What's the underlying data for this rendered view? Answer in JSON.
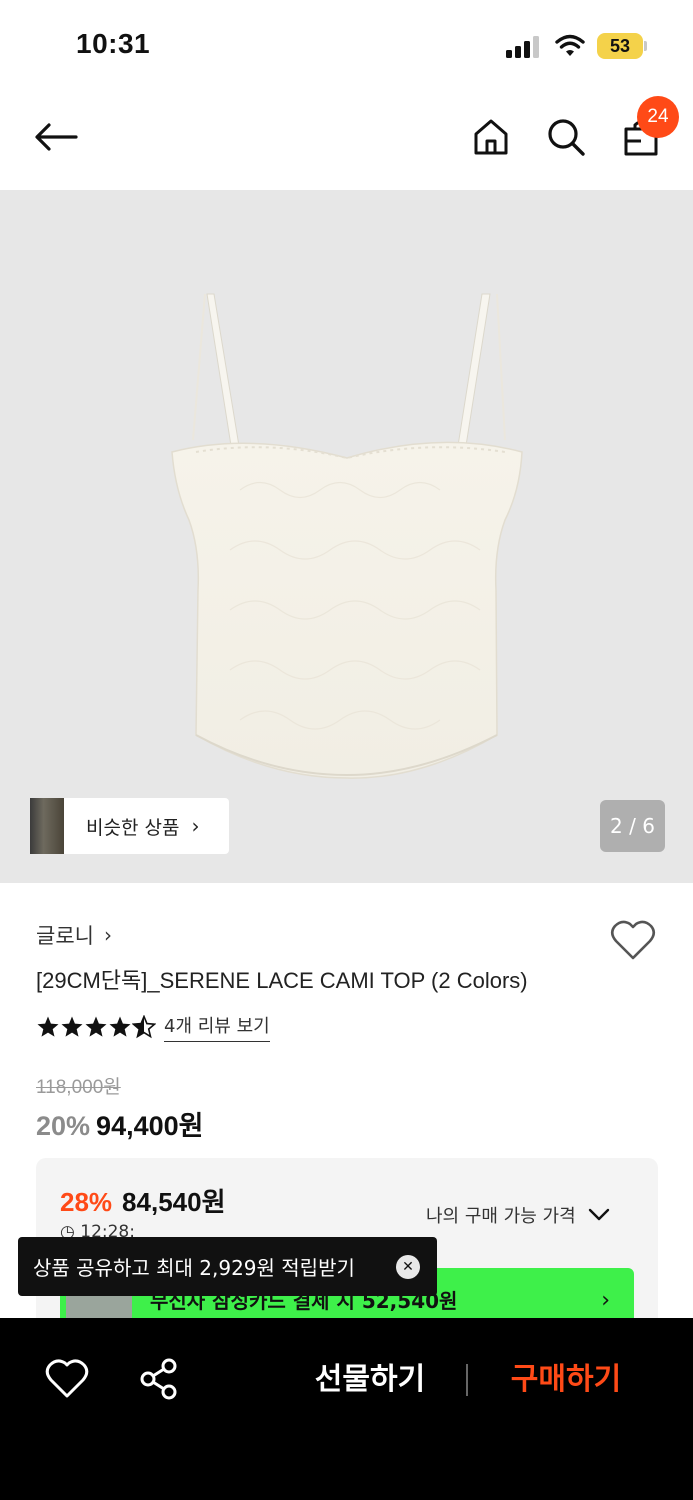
{
  "status_bar": {
    "time": "10:31",
    "battery": "53"
  },
  "nav": {
    "cart_count": "24"
  },
  "gallery": {
    "similar_label": "비슷한 상품",
    "pager": "2 / 6"
  },
  "product": {
    "brand": "글로니",
    "title": "[29CM단독]_SERENE LACE CAMI TOP (2 Colors)",
    "rating": 4.5,
    "review_link": "4개 리뷰 보기",
    "original_price": "118,000원",
    "discount": "20%",
    "sale_price": "94,400원"
  },
  "best_price": {
    "discount": "28%",
    "price": "84,540원",
    "timer": "12:28:",
    "my_price_label": "나의 구매 가능 가격",
    "promo_text": "무신사 삼성카드 결제 시 52,540원"
  },
  "toast": {
    "text": "상품 공유하고 최대 2,929원 적립받기"
  },
  "bottom_bar": {
    "gift_label": "선물하기",
    "buy_label": "구매하기"
  },
  "colors": {
    "accent": "#ff4a17",
    "promo_green": "#3ef04a",
    "battery": "#f4d24a"
  }
}
